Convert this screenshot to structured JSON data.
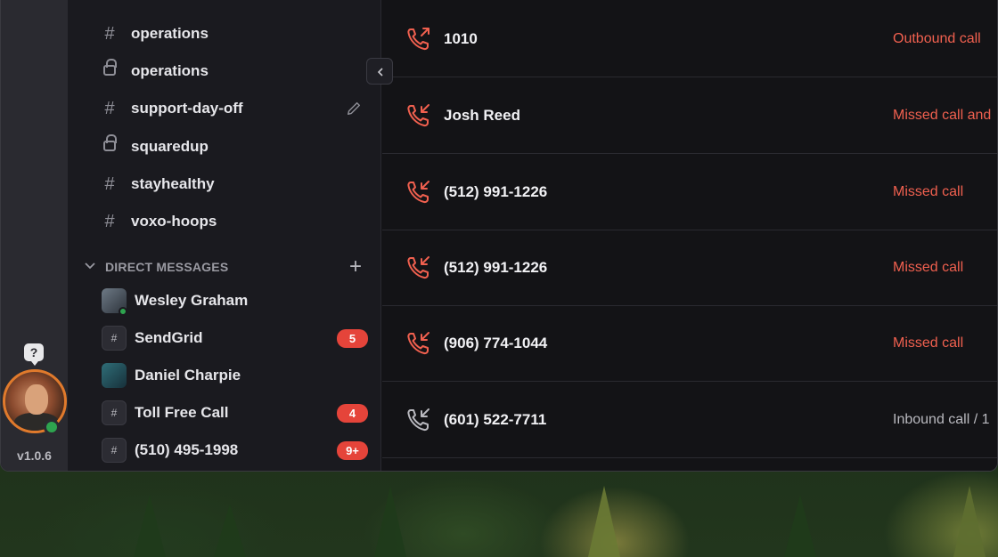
{
  "app": {
    "version": "v1.0.6"
  },
  "rail": {
    "help_glyph": "?"
  },
  "sidebar": {
    "channels": [
      {
        "icon": "hash",
        "label": "operations"
      },
      {
        "icon": "lock",
        "label": "operations"
      },
      {
        "icon": "hash",
        "label": "support-day-off",
        "editable": true
      },
      {
        "icon": "lock",
        "label": "squaredup"
      },
      {
        "icon": "hash",
        "label": "stayhealthy"
      },
      {
        "icon": "hash",
        "label": "voxo-hoops"
      }
    ],
    "direct_messages": {
      "title": "DIRECT MESSAGES",
      "add_label": "+",
      "items": [
        {
          "name": "Wesley Graham",
          "type": "avatar",
          "online": true,
          "badge": ""
        },
        {
          "name": "SendGrid",
          "type": "hash",
          "badge": "5"
        },
        {
          "name": "Daniel Charpie",
          "type": "avatar",
          "badge": ""
        },
        {
          "name": "Toll Free Call",
          "type": "hash",
          "badge": "4"
        },
        {
          "name": "(510) 495-1998",
          "type": "hash",
          "badge": "9+"
        }
      ]
    }
  },
  "calls": [
    {
      "number": "1010",
      "status": "Outbound call",
      "direction": "outbound",
      "color": "#f0604f"
    },
    {
      "number": "Josh Reed",
      "status": "Missed call and",
      "direction": "inbound",
      "color": "#f0604f"
    },
    {
      "number": "(512) 991-1226",
      "status": "Missed call",
      "direction": "inbound",
      "color": "#f0604f"
    },
    {
      "number": "(512) 991-1226",
      "status": "Missed call",
      "direction": "inbound",
      "color": "#f0604f"
    },
    {
      "number": "(906) 774-1044",
      "status": "Missed call",
      "direction": "inbound",
      "color": "#f0604f"
    },
    {
      "number": "(601) 522-7711",
      "status": "Inbound call / 1",
      "direction": "inbound",
      "color": "#b9b9bf"
    }
  ],
  "colors": {
    "accent_red": "#e5443a",
    "missed": "#f0604f",
    "online": "#2ea44f"
  }
}
